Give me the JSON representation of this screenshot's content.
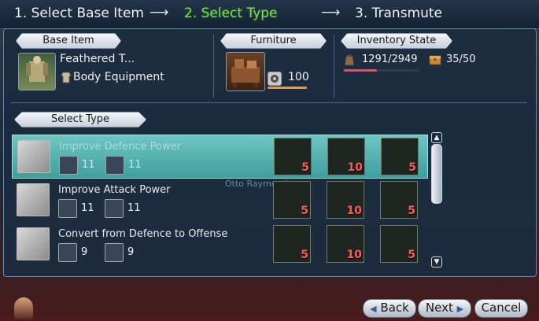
{
  "steps": [
    {
      "label": "1. Select Base Item"
    },
    {
      "label": "2. Select Type"
    },
    {
      "label": "3. Transmute"
    }
  ],
  "step_arrows": [
    "⟶",
    "⟶"
  ],
  "base_item": {
    "header": "Base Item",
    "name": "Feathered T...",
    "category": "Body Equipment"
  },
  "furniture": {
    "header": "Furniture",
    "durability": "100"
  },
  "inventory": {
    "header": "Inventory State",
    "weight": "1291/2949",
    "slots": "35/50"
  },
  "select_type": {
    "header": "Select Type"
  },
  "types": [
    {
      "title": "Improve Defence Power",
      "stat_a": "11",
      "stat_b": "11",
      "mat1": "5",
      "mat2": "10",
      "mat3": "5",
      "selected": true
    },
    {
      "title": "Improve Attack Power",
      "stat_a": "11",
      "stat_b": "11",
      "mat1": "5",
      "mat2": "10",
      "mat3": "5",
      "selected": false
    },
    {
      "title": "Convert from Defence to Offense",
      "stat_a": "9",
      "stat_b": "9",
      "mat1": "5",
      "mat2": "10",
      "mat3": "5",
      "selected": false
    }
  ],
  "background_text": {
    "player_name": "Otto Raymond"
  },
  "buttons": {
    "back": "Back",
    "next": "Next",
    "cancel": "Cancel"
  },
  "colors": {
    "active_step": "#7de05a",
    "selected_row": "#5ab3b1",
    "material_count": "#ff5a5a"
  }
}
